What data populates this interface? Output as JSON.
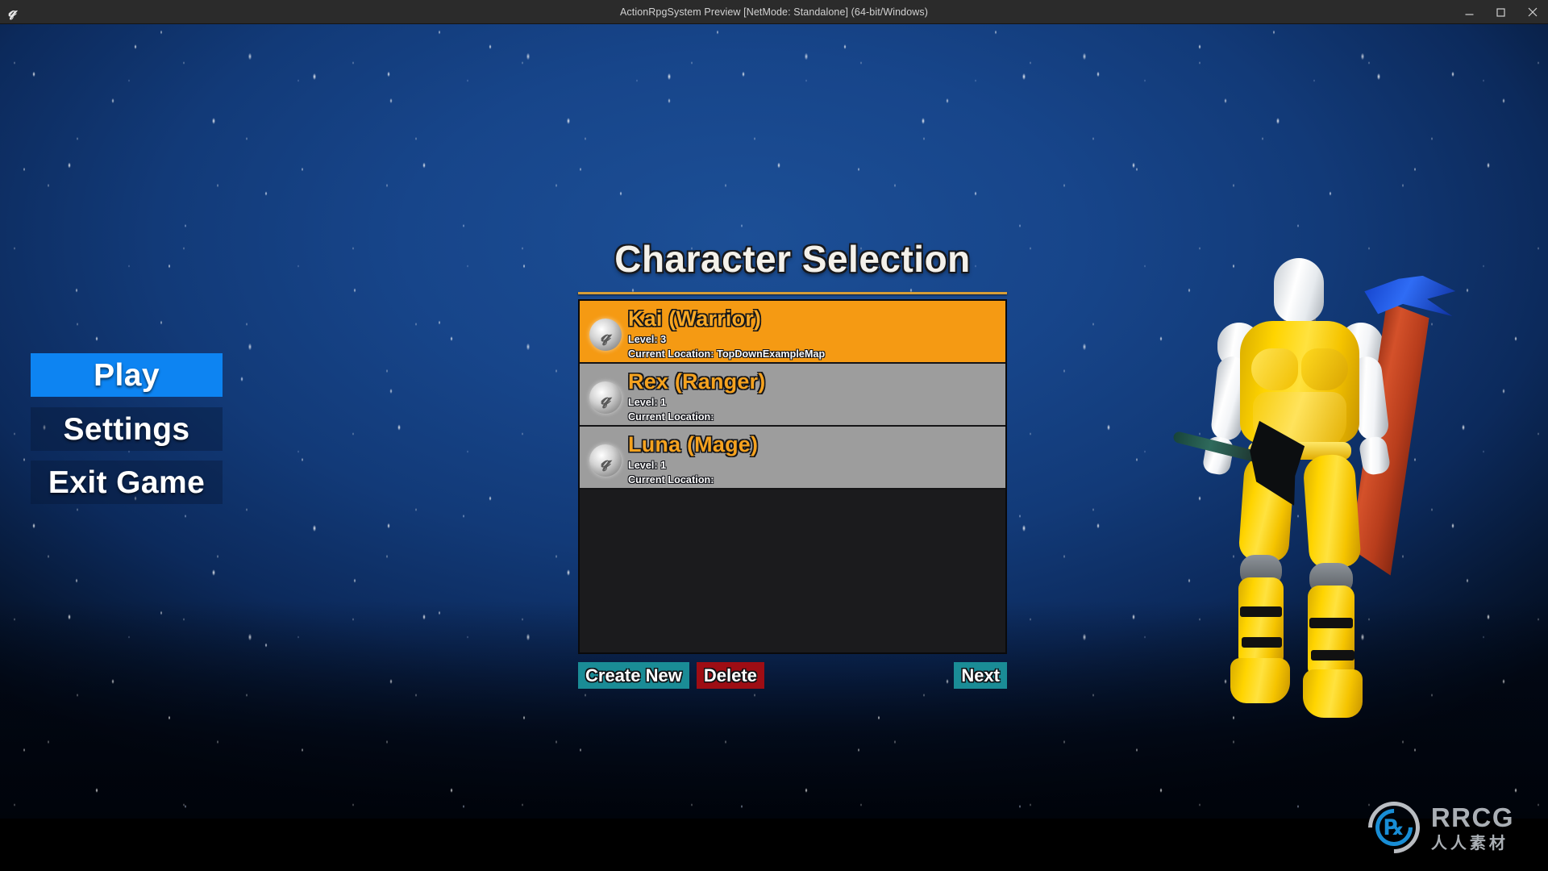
{
  "window": {
    "title": "ActionRpgSystem Preview [NetMode: Standalone]  (64-bit/Windows)",
    "app_icon": "unreal-engine-logo",
    "controls": {
      "minimize": "minimize-icon",
      "maximize": "maximize-icon",
      "close": "close-icon"
    }
  },
  "main_menu": {
    "items": [
      {
        "label": "Play",
        "state": "highlighted",
        "color": "#0d84f2"
      },
      {
        "label": "Settings",
        "state": "normal",
        "color": "#081838"
      },
      {
        "label": "Exit Game",
        "state": "normal",
        "color": "#081838"
      }
    ]
  },
  "character_selection": {
    "title": "Character Selection",
    "divider_color": "#d59d38",
    "list_background": "#1b1b1d",
    "selected_row_color": "#f59a13",
    "normal_row_color": "#9d9d9d",
    "name_color": "#f5a21f",
    "labels": {
      "level_prefix": "Level:",
      "location_prefix": "Current Location:"
    },
    "characters": [
      {
        "icon": "unreal-engine-badge-icon",
        "name": "Kai (Warrior)",
        "level_text": "Level: 3",
        "location_text": "Current Location: TopDownExampleMap",
        "level": 3,
        "location": "TopDownExampleMap",
        "selected": true
      },
      {
        "icon": "unreal-engine-badge-icon",
        "name": "Rex (Ranger)",
        "level_text": "Level: 1",
        "location_text": "Current Location:",
        "level": 1,
        "location": "",
        "selected": false
      },
      {
        "icon": "unreal-engine-badge-icon",
        "name": "Luna (Mage)",
        "level_text": "Level: 1",
        "location_text": "Current Location:",
        "level": 1,
        "location": "",
        "selected": false
      }
    ],
    "actions": {
      "create_new": {
        "label": "Create New",
        "color": "#1a8c96"
      },
      "delete": {
        "label": "Delete",
        "color": "#9e0d14"
      },
      "next": {
        "label": "Next",
        "color": "#1a8c96"
      }
    }
  },
  "scene": {
    "background": "starfield-night-sky",
    "sky_color": "#17458a",
    "character_preview": "yellow-armored-warrior-with-axe-and-sword"
  },
  "watermark": {
    "brand": "RRCG",
    "subtitle": "人人素材",
    "mark": "rrcg-logo-icon"
  }
}
